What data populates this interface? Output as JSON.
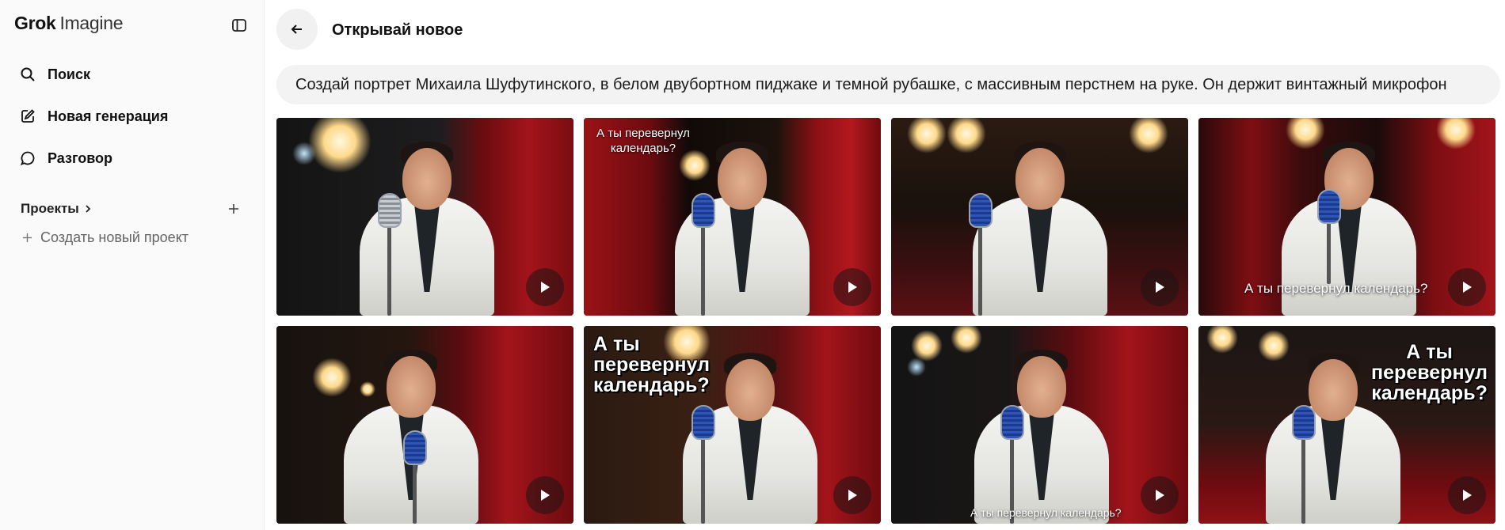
{
  "sidebar": {
    "brand_grok": "Grok",
    "brand_imagine": "Imagine",
    "nav": [
      {
        "label": "Поиск",
        "icon": "search-icon"
      },
      {
        "label": "Новая генерация",
        "icon": "edit-icon"
      },
      {
        "label": "Разговор",
        "icon": "chat-bubble-icon"
      }
    ],
    "projects_label": "Проекты",
    "create_project_label": "Создать новый проект"
  },
  "header": {
    "title": "Открывай новое"
  },
  "prompt": {
    "text": "Создай портрет Михаила Шуфутинского, в белом двубортном пиджаке и темной рубашке, с массивным перстнем на руке. Он держит винтажный микрофон"
  },
  "gallery": {
    "items": [
      {
        "caption": ""
      },
      {
        "caption": "А ты перевернул\nкалендарь?"
      },
      {
        "caption": ""
      },
      {
        "caption": "А ты перевернул календарь?"
      },
      {
        "caption": ""
      },
      {
        "caption": "А ты\nперевернул\nкалендарь?"
      },
      {
        "caption": "А ты перевернул календарь?"
      },
      {
        "caption": "А ты\nперевернул\nкалендарь?"
      }
    ]
  },
  "colors": {
    "accent_text": "#111111",
    "sidebar_bg": "#fafafa",
    "prompt_bg": "#f3f3f3",
    "curtain_red": "#8e1116"
  }
}
